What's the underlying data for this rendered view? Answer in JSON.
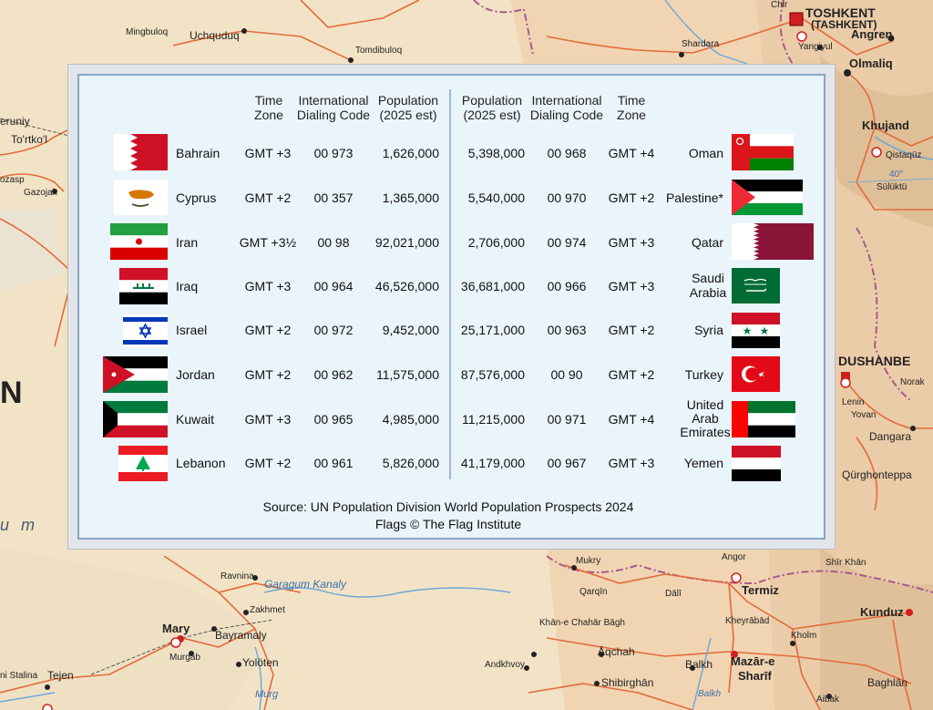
{
  "map_labels": {
    "mingbuloq": "Mingbuloq",
    "uchquduq": "Uchquduq",
    "tomdibuloq": "Tomdibuloq",
    "shardara": "Shardara",
    "tashkent": "TOSHKENT",
    "tashkent_alt": "(TASHKENT)",
    "yangiyul": "Yangiyul",
    "angren": "Angren",
    "olmaliq": "Olmaliq",
    "khujand": "Khujand",
    "qistaquz": "Qistaqüz",
    "sulukt": "Sülüktü",
    "lat40": "40°",
    "beruniy": "eruniy",
    "tortkol": "To'rtko'l",
    "gazojak": "Gazojak",
    "ozasp": "ozasp",
    "big_n": "N",
    "garagum": "u m",
    "dushanbe": "DUSHANBE",
    "lenin": "Lenin",
    "norak": "Norak",
    "yovan": "Yovan",
    "dangara": "Dangara",
    "qurghonteppa": "Qürghonteppa",
    "ravnina": "Ravnina",
    "garagum_kanaly": "Garagum Kanaly",
    "zakhmet": "Zakhmet",
    "mary": "Mary",
    "bayramaly": "Bayramaly",
    "murgab": "Murgab",
    "yoloten": "Yolöten",
    "murgab_river": "Murg",
    "stalina": "ni Stalina",
    "tejen": "Tejen",
    "mukry": "Mukry",
    "angor": "Angor",
    "shir_khan": "Shīr Khān",
    "qarqin": "Qarqīn",
    "dali": "Dālī",
    "termiz": "Termiz",
    "kheyrabad": "Kheyrābād",
    "kunduz": "Kunduz",
    "khan_e_chahar": "Khān-e Chahār Bāgh",
    "aqchah": "Āqchah",
    "kholm": "Kholm",
    "andkhvoy": "Andkhvoy",
    "balkh": "Balkh",
    "mazar": "Mazār-e",
    "sharif": "Sharīf",
    "shibirghan": "Shibirghān",
    "balkh_river": "Balkh",
    "aibak": "Aibak",
    "baghlan": "Baghlān",
    "chir": "Chir"
  },
  "headers": {
    "left_tz": [
      "Time",
      "Zone"
    ],
    "left_dial": [
      "International",
      "Dialing Code"
    ],
    "left_pop": [
      "Population",
      "(2025 est)"
    ],
    "right_pop": [
      "Population",
      "(2025 est)"
    ],
    "right_dial": [
      "International",
      "Dialing Code"
    ],
    "right_tz": [
      "Time",
      "Zone"
    ]
  },
  "left_rows": [
    {
      "country": "Bahrain",
      "tz": "GMT +3",
      "dial": "00 973",
      "pop": "1,626,000"
    },
    {
      "country": "Cyprus",
      "tz": "GMT +2",
      "dial": "00 357",
      "pop": "1,365,000"
    },
    {
      "country": "Iran",
      "tz": "GMT +3½",
      "dial": "00 98",
      "pop": "92,021,000"
    },
    {
      "country": "Iraq",
      "tz": "GMT +3",
      "dial": "00 964",
      "pop": "46,526,000"
    },
    {
      "country": "Israel",
      "tz": "GMT +2",
      "dial": "00 972",
      "pop": "9,452,000"
    },
    {
      "country": "Jordan",
      "tz": "GMT +2",
      "dial": "00 962",
      "pop": "11,575,000"
    },
    {
      "country": "Kuwait",
      "tz": "GMT +3",
      "dial": "00 965",
      "pop": "4,985,000"
    },
    {
      "country": "Lebanon",
      "tz": "GMT +2",
      "dial": "00 961",
      "pop": "5,826,000"
    }
  ],
  "right_rows": [
    {
      "country": "Oman",
      "tz": "GMT +4",
      "dial": "00 968",
      "pop": "5,398,000"
    },
    {
      "country": "Palestine*",
      "tz": "GMT +2",
      "dial": "00 970",
      "pop": "5,540,000"
    },
    {
      "country": "Qatar",
      "tz": "GMT +3",
      "dial": "00 974",
      "pop": "2,706,000"
    },
    {
      "country": "Saudi Arabia",
      "tz": "GMT +3",
      "dial": "00 966",
      "pop": "36,681,000"
    },
    {
      "country": "Syria",
      "tz": "GMT +2",
      "dial": "00 963",
      "pop": "25,171,000"
    },
    {
      "country": "Turkey",
      "tz": "GMT +2",
      "dial": "00 90",
      "pop": "87,576,000"
    },
    {
      "country": "United Arab Emirates",
      "tz": "GMT +4",
      "dial": "00 971",
      "pop": "11,215,000"
    },
    {
      "country": "Yemen",
      "tz": "GMT +3",
      "dial": "00 967",
      "pop": "41,179,000"
    }
  ],
  "right_country_lines": {
    "saudi": [
      "Saudi",
      "Arabia"
    ],
    "uae": [
      "United",
      "Arab",
      "Emirates"
    ]
  },
  "source": "Source:  UN Population Division World Population Prospects 2024",
  "credit": "Flags © The Flag Institute"
}
